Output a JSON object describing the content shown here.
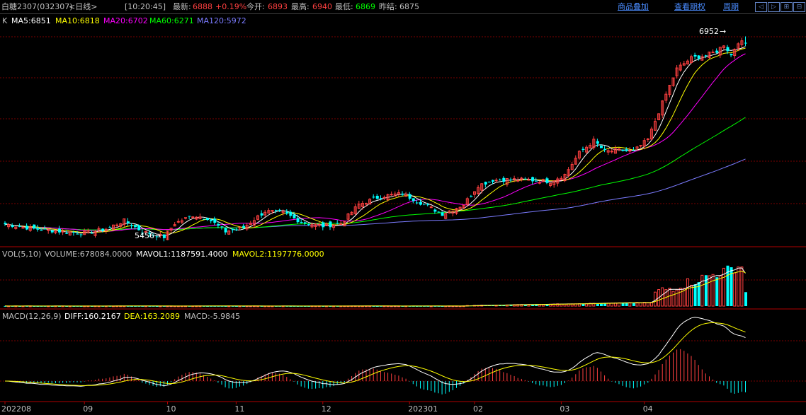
{
  "header": {
    "title": "白糖2307",
    "code": "(032307)",
    "period": "<日线>",
    "time": "[10:20:45]",
    "latest_label": "最新:",
    "latest_value": "6888",
    "change": "+0.19%",
    "open_label": "今开:",
    "open_value": "6893",
    "high_label": "最高:",
    "high_value": "6940",
    "low_label": "最低:",
    "low_value": "6869",
    "settle_label": "昨结:",
    "settle_value": "6875",
    "links": [
      "商品叠加",
      "查看期权",
      "周期"
    ],
    "nav_icons": [
      "left-arrow-icon",
      "right-arrow-icon",
      "zoom-in-icon",
      "zoom-out-icon"
    ],
    "nav_glyphs": [
      "◁",
      "▷",
      "⊞",
      "⊟"
    ]
  },
  "colors": {
    "up": "#ff4040",
    "down": "#00ffff",
    "ma5": "#ffffff",
    "ma10": "#ffff00",
    "ma20": "#ff00ff",
    "ma60": "#00ff00",
    "ma120": "#7b7bff",
    "grid": "#7a0000",
    "link": "#4a8cff"
  },
  "legend": {
    "k": "K",
    "ma5": "MA5:6851",
    "ma10": "MA10:6818",
    "ma20": "MA20:6702",
    "ma60": "MA60:6271",
    "ma120": "MA120:5972",
    "vol": "VOL(5,10)",
    "volume": "VOLUME:678084.0000",
    "mavol1": "MAVOL1:1187591.4000",
    "mavol2": "MAVOL2:1197776.0000",
    "macd": "MACD(12,26,9)",
    "diff": "DIFF:160.2167",
    "dea": "DEA:163.2089",
    "macd_value": "MACD:-5.9845"
  },
  "annotations": {
    "low": "5456",
    "high": "6952"
  },
  "chart_data": {
    "type": "candlestick",
    "x_axis_labels": [
      "202208",
      "09",
      "10",
      "11",
      "12",
      "202301",
      "02",
      "03",
      "04"
    ],
    "label_bar_index": [
      0,
      22,
      45,
      64,
      88,
      112,
      130,
      154,
      177
    ],
    "price_anchors": [
      {
        "bar": 0,
        "close": 5555
      },
      {
        "bar": 8,
        "close": 5520
      },
      {
        "bar": 16,
        "close": 5500
      },
      {
        "bar": 22,
        "close": 5490
      },
      {
        "bar": 28,
        "close": 5520
      },
      {
        "bar": 33,
        "close": 5580
      },
      {
        "bar": 38,
        "close": 5500
      },
      {
        "bar": 44,
        "close": 5460
      },
      {
        "bar": 47,
        "close": 5560
      },
      {
        "bar": 52,
        "close": 5620
      },
      {
        "bar": 56,
        "close": 5600
      },
      {
        "bar": 61,
        "close": 5500
      },
      {
        "bar": 66,
        "close": 5530
      },
      {
        "bar": 72,
        "close": 5650
      },
      {
        "bar": 77,
        "close": 5640
      },
      {
        "bar": 82,
        "close": 5570
      },
      {
        "bar": 88,
        "close": 5540
      },
      {
        "bar": 93,
        "close": 5560
      },
      {
        "bar": 98,
        "close": 5700
      },
      {
        "bar": 104,
        "close": 5760
      },
      {
        "bar": 110,
        "close": 5780
      },
      {
        "bar": 116,
        "close": 5700
      },
      {
        "bar": 121,
        "close": 5630
      },
      {
        "bar": 127,
        "close": 5700
      },
      {
        "bar": 131,
        "close": 5840
      },
      {
        "bar": 135,
        "close": 5880
      },
      {
        "bar": 140,
        "close": 5885
      },
      {
        "bar": 145,
        "close": 5880
      },
      {
        "bar": 151,
        "close": 5870
      },
      {
        "bar": 155,
        "close": 5920
      },
      {
        "bar": 159,
        "close": 6080
      },
      {
        "bar": 163,
        "close": 6170
      },
      {
        "bar": 166,
        "close": 6090
      },
      {
        "bar": 170,
        "close": 6100
      },
      {
        "bar": 174,
        "close": 6090
      },
      {
        "bar": 178,
        "close": 6180
      },
      {
        "bar": 182,
        "close": 6450
      },
      {
        "bar": 186,
        "close": 6700
      },
      {
        "bar": 190,
        "close": 6780
      },
      {
        "bar": 194,
        "close": 6800
      },
      {
        "bar": 197,
        "close": 6830
      },
      {
        "bar": 199,
        "close": 6880
      },
      {
        "bar": 201,
        "close": 6800
      },
      {
        "bar": 203,
        "close": 6900
      },
      {
        "bar": 205,
        "close": 6888
      }
    ],
    "ma_end_values": {
      "ma5": 6851,
      "ma10": 6818,
      "ma20": 6702,
      "ma60": 6271,
      "ma120": 5972
    },
    "price_range": [
      5420,
      7000
    ],
    "volume_last": 678084,
    "mavol1_last": 1187591.4,
    "mavol2_last": 1197776,
    "macd_last": {
      "diff": 160.2167,
      "dea": 163.2089,
      "macd": -5.9845
    },
    "grid": true
  }
}
